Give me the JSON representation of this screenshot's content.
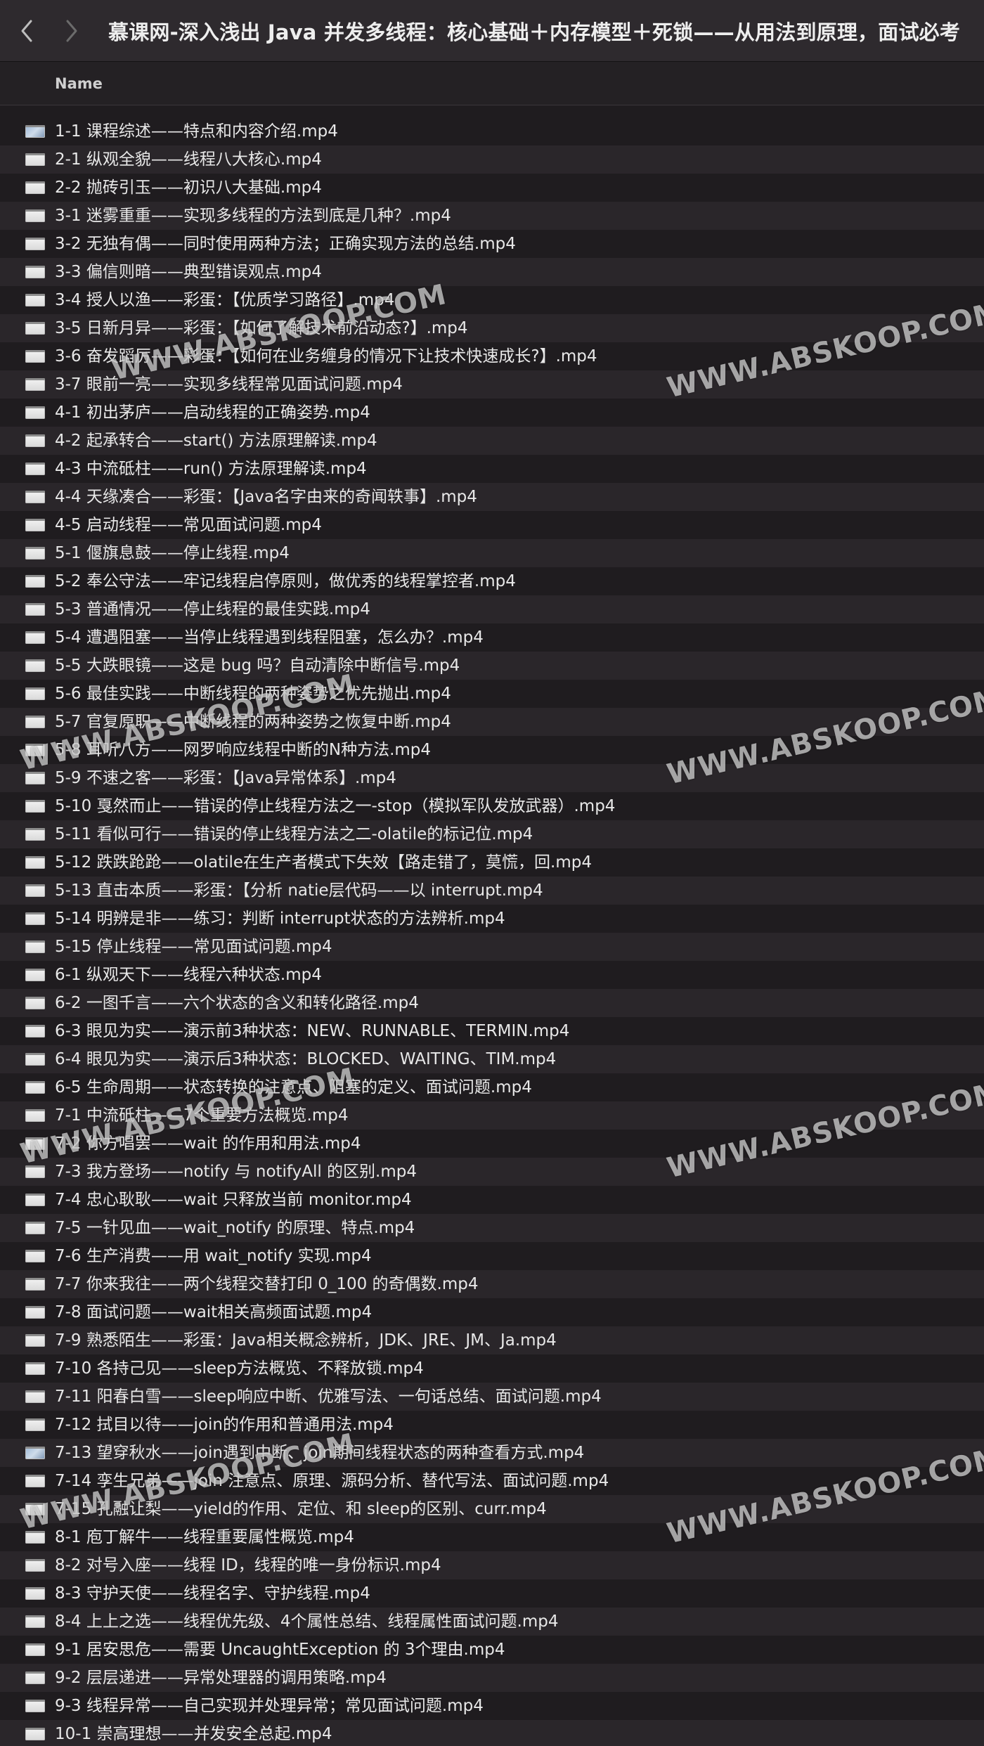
{
  "window": {
    "title": "慕课网-深入浅出 Java 并发多线程：核心基础＋内存模型＋死锁——从用法到原理，面试必考"
  },
  "header": {
    "name_column": "Name"
  },
  "watermark": {
    "text": "WWW.ABSKOOP.COM"
  },
  "files": [
    {
      "name": "1-1 课程综述——特点和内容介绍.mp4",
      "icon": "video-thumbnail-icon"
    },
    {
      "name": "2-1 纵观全貌——线程八大核心.mp4",
      "icon": "video-file-icon"
    },
    {
      "name": "2-2 抛砖引玉——初识八大基础.mp4",
      "icon": "video-file-icon"
    },
    {
      "name": "3-1 迷雾重重——实现多线程的方法到底是几种？.mp4",
      "icon": "video-file-icon"
    },
    {
      "name": "3-2 无独有偶——同时使用两种方法；正确实现方法的总结.mp4",
      "icon": "video-file-icon"
    },
    {
      "name": "3-3 偏信则暗——典型错误观点.mp4",
      "icon": "video-file-icon"
    },
    {
      "name": "3-4 授人以渔——彩蛋：【优质学习路径】.mp4",
      "icon": "video-file-icon"
    },
    {
      "name": "3-5 日新月异——彩蛋：【如何了解技术前沿动态?】.mp4",
      "icon": "video-file-icon"
    },
    {
      "name": "3-6 奋发蹈厉——彩蛋：【如何在业务缠身的情况下让技术快速成长?】.mp4",
      "icon": "video-file-icon"
    },
    {
      "name": "3-7 眼前一亮——实现多线程常见面试问题.mp4",
      "icon": "video-file-icon"
    },
    {
      "name": "4-1 初出茅庐——启动线程的正确姿势.mp4",
      "icon": "video-file-icon"
    },
    {
      "name": "4-2 起承转合——start() 方法原理解读.mp4",
      "icon": "video-file-icon"
    },
    {
      "name": "4-3 中流砥柱——run() 方法原理解读.mp4",
      "icon": "video-file-icon"
    },
    {
      "name": "4-4 天缘凑合——彩蛋：【Java名字由来的奇闻轶事】.mp4",
      "icon": "video-file-icon"
    },
    {
      "name": "4-5 启动线程——常见面试问题.mp4",
      "icon": "video-file-icon"
    },
    {
      "name": "5-1 偃旗息鼓——停止线程.mp4",
      "icon": "video-file-icon"
    },
    {
      "name": "5-2 奉公守法——牢记线程启停原则，做优秀的线程掌控者.mp4",
      "icon": "video-file-icon"
    },
    {
      "name": "5-3 普通情况——停止线程的最佳实践.mp4",
      "icon": "video-file-icon"
    },
    {
      "name": "5-4 遭遇阻塞——当停止线程遇到线程阻塞，怎么办？.mp4",
      "icon": "video-file-icon"
    },
    {
      "name": "5-5 大跌眼镜——这是 bug 吗？自动清除中断信号.mp4",
      "icon": "video-file-icon"
    },
    {
      "name": "5-6 最佳实践——中断线程的两种姿势之优先抛出.mp4",
      "icon": "video-file-icon"
    },
    {
      "name": "5-7 官复原职——中断线程的两种姿势之恢复中断.mp4",
      "icon": "video-file-icon"
    },
    {
      "name": "5-8 耳听八方——网罗响应线程中断的N种方法.mp4",
      "icon": "video-file-icon"
    },
    {
      "name": "5-9 不速之客——彩蛋：【Java异常体系】.mp4",
      "icon": "video-file-icon"
    },
    {
      "name": "5-10 戛然而止——错误的停止线程方法之一-stop（模拟军队发放武器）.mp4",
      "icon": "video-file-icon"
    },
    {
      "name": "5-11 看似可行——错误的停止线程方法之二-olatile的标记位.mp4",
      "icon": "video-file-icon"
    },
    {
      "name": "5-12 跌跌跄跄——olatile在生产者模式下失效【路走错了，莫慌，回.mp4",
      "icon": "video-file-icon"
    },
    {
      "name": "5-13 直击本质——彩蛋：【分析 natie层代码——以 interrupt.mp4",
      "icon": "video-file-icon"
    },
    {
      "name": "5-14 明辨是非——练习：判断 interrupt状态的方法辨析.mp4",
      "icon": "video-file-icon"
    },
    {
      "name": "5-15 停止线程——常见面试问题.mp4",
      "icon": "video-file-icon"
    },
    {
      "name": "6-1 纵观天下——线程六种状态.mp4",
      "icon": "video-file-icon"
    },
    {
      "name": "6-2 一图千言——六个状态的含义和转化路径.mp4",
      "icon": "video-file-icon"
    },
    {
      "name": "6-3 眼见为实——演示前3种状态：NEW、RUNNABLE、TERMIN.mp4",
      "icon": "video-file-icon"
    },
    {
      "name": "6-4 眼见为实——演示后3种状态：BLOCKED、WAITING、TIM.mp4",
      "icon": "video-file-icon"
    },
    {
      "name": "6-5 生命周期——状态转换的注意点、阻塞的定义、面试问题.mp4",
      "icon": "video-file-icon"
    },
    {
      "name": "7-1 中流砥柱——7个重要方法概览.mp4",
      "icon": "video-file-icon"
    },
    {
      "name": "7-2 你方唱罢——wait 的作用和用法.mp4",
      "icon": "video-file-icon"
    },
    {
      "name": "7-3 我方登场——notify 与 notifyAll 的区别.mp4",
      "icon": "video-file-icon"
    },
    {
      "name": "7-4 忠心耿耿——wait 只释放当前 monitor.mp4",
      "icon": "video-file-icon"
    },
    {
      "name": "7-5 一针见血——wait_notify 的原理、特点.mp4",
      "icon": "video-file-icon"
    },
    {
      "name": "7-6 生产消费——用 wait_notify 实现.mp4",
      "icon": "video-file-icon"
    },
    {
      "name": "7-7 你来我往——两个线程交替打印 0_100 的奇偶数.mp4",
      "icon": "video-file-icon"
    },
    {
      "name": "7-8 面试问题——wait相关高频面试题.mp4",
      "icon": "video-file-icon"
    },
    {
      "name": "7-9 熟悉陌生——彩蛋：Java相关概念辨析，JDK、JRE、JM、Ja.mp4",
      "icon": "video-file-icon"
    },
    {
      "name": "7-10 各持己见——sleep方法概览、不释放锁.mp4",
      "icon": "video-file-icon"
    },
    {
      "name": "7-11 阳春白雪——sleep响应中断、优雅写法、一句话总结、面试问题.mp4",
      "icon": "video-file-icon"
    },
    {
      "name": "7-12 拭目以待——join的作用和普通用法.mp4",
      "icon": "video-file-icon"
    },
    {
      "name": "7-13 望穿秋水——join遇到中断、join期间线程状态的两种查看方式.mp4",
      "icon": "video-thumbnail-icon"
    },
    {
      "name": "7-14 孪生兄弟——join 注意点、原理、源码分析、替代写法、面试问题.mp4",
      "icon": "video-file-icon"
    },
    {
      "name": "7-15 孔融让梨——yield的作用、定位、和 sleep的区别、curr.mp4",
      "icon": "video-file-icon"
    },
    {
      "name": "8-1 庖丁解牛——线程重要属性概览.mp4",
      "icon": "video-file-icon"
    },
    {
      "name": "8-2 对号入座——线程 ID，线程的唯一身份标识.mp4",
      "icon": "video-file-icon"
    },
    {
      "name": "8-3 守护天使——线程名字、守护线程.mp4",
      "icon": "video-file-icon"
    },
    {
      "name": "8-4 上上之选——线程优先级、4个属性总结、线程属性面试问题.mp4",
      "icon": "video-file-icon"
    },
    {
      "name": "9-1 居安思危——需要 UncaughtException 的 3个理由.mp4",
      "icon": "video-file-icon"
    },
    {
      "name": "9-2 层层递进——异常处理器的调用策略.mp4",
      "icon": "video-file-icon"
    },
    {
      "name": "9-3 线程异常——自己实现并处理异常；常见面试问题.mp4",
      "icon": "video-file-icon"
    },
    {
      "name": "10-1 崇高理想——并发安全总起.mp4",
      "icon": "video-file-icon"
    }
  ]
}
